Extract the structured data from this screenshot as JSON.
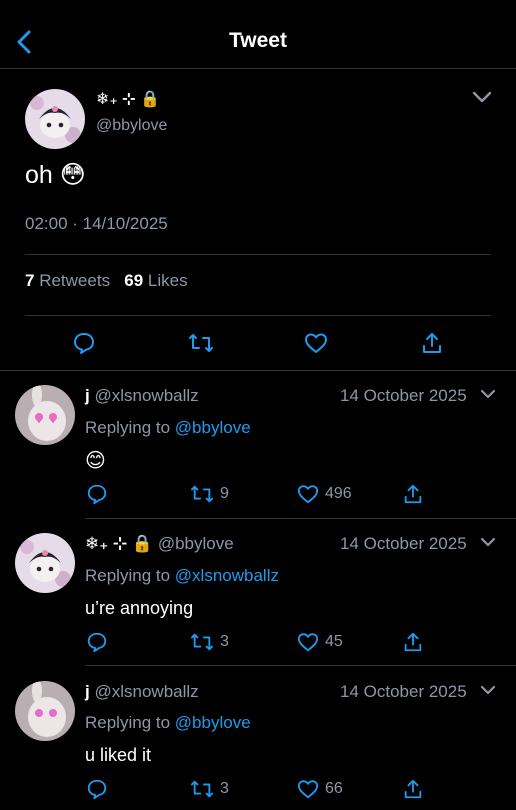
{
  "header": {
    "title": "Tweet"
  },
  "tweet": {
    "display_name": "❄₊ ⊹ 🔒",
    "handle": "@bbylove",
    "text": "oh 😳",
    "timestamp": "02:00 · 14/10/2025",
    "retweets_count": "7",
    "retweets_label": "Retweets",
    "likes_count": "69",
    "likes_label": "Likes"
  },
  "replies": [
    {
      "name": "j",
      "handle": "@xlsnowballz",
      "date": "14 October 2025",
      "replying_prefix": "Replying to",
      "replying_to": "@bbylove",
      "text": "😊",
      "retweets": "9",
      "likes": "496"
    },
    {
      "name": "❄₊ ⊹ 🔒",
      "handle": "@bbylove",
      "date": "14 October 2025",
      "replying_prefix": "Replying to",
      "replying_to": "@xlsnowballz",
      "text": "u’re annoying",
      "retweets": "3",
      "likes": "45"
    },
    {
      "name": "j",
      "handle": "@xlsnowballz",
      "date": "14 October 2025",
      "replying_prefix": "Replying to",
      "replying_to": "@bbylove",
      "text": "u liked it",
      "retweets": "3",
      "likes": "66"
    }
  ],
  "colors": {
    "accent": "#1d9bf0",
    "muted": "#8b98a5",
    "divider": "#2f3336",
    "background": "#000000"
  }
}
